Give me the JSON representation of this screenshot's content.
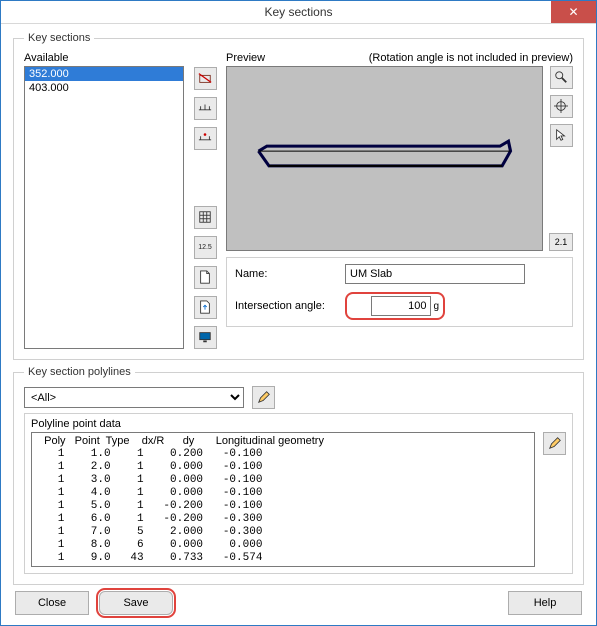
{
  "window": {
    "title": "Key sections"
  },
  "keysections": {
    "legend": "Key sections",
    "available_label": "Available",
    "items": [
      {
        "label": "352.000",
        "selected": true
      },
      {
        "label": "403.000",
        "selected": false
      }
    ],
    "preview_label": "Preview",
    "rotation_note": "(Rotation angle is not included in preview)",
    "name_label": "Name:",
    "name_value": "UM Slab",
    "angle_label": "Intersection angle:",
    "angle_value": "100",
    "angle_unit": "g",
    "side_scale": "2.1",
    "tool_12_5": "12.5"
  },
  "polylines": {
    "legend": "Key section polylines",
    "dropdown_selected": "<All>",
    "pointdata_label": "Polyline point data",
    "headers": "  Poly   Point  Type    dx/R      dy       Longitudinal geometry",
    "rows": [
      "   1    1.0    1    0.200   -0.100",
      "   1    2.0    1    0.000   -0.100",
      "   1    3.0    1    0.000   -0.100",
      "   1    4.0    1    0.000   -0.100",
      "   1    5.0    1   -0.200   -0.100",
      "   1    6.0    1   -0.200   -0.300",
      "   1    7.0    5    2.000   -0.300",
      "   1    8.0    6    0.000    0.000",
      "   1    9.0   43    0.733   -0.574"
    ]
  },
  "buttons": {
    "close": "Close",
    "save": "Save",
    "help": "Help"
  }
}
